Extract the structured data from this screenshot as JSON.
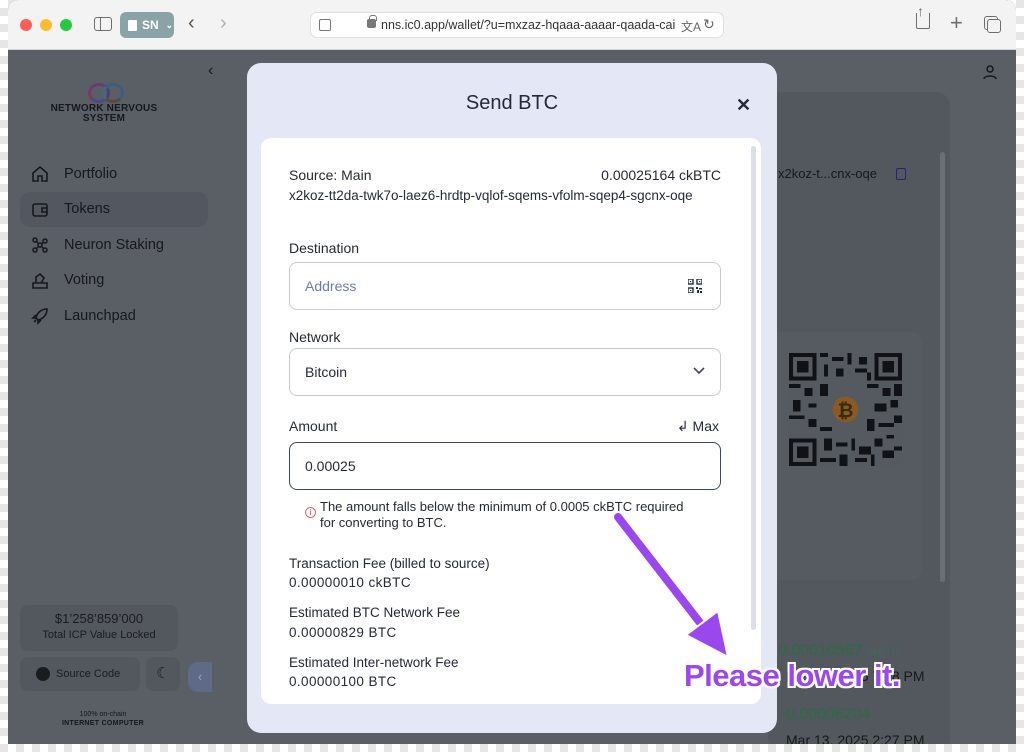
{
  "browser": {
    "tab_group_label": "SN",
    "url": "nns.ic0.app/wallet/?u=mxzaz-hqaaa-aaaar-qaada-cai"
  },
  "app": {
    "logo_line1": "NETWORK NERVOUS",
    "logo_line2": "SYSTEM",
    "nav": [
      {
        "label": "Portfolio",
        "icon": "home-icon"
      },
      {
        "label": "Tokens",
        "icon": "wallet-icon",
        "active": true
      },
      {
        "label": "Neuron Staking",
        "icon": "neuron-icon"
      },
      {
        "label": "Voting",
        "icon": "voting-icon"
      },
      {
        "label": "Launchpad",
        "icon": "rocket-icon"
      }
    ],
    "tvl_amount": "$1’258’859’000",
    "tvl_label": "Total ICP Value Locked",
    "source_code_label": "Source Code",
    "footer_line1": "100% on-chain",
    "footer_line2": "INTERNET COMPUTER",
    "right_address": "x2koz-t...cnx-oqe",
    "tx1_amount": "0.00010567",
    "tx1_unit": "ckBTC",
    "tx1_date": "Mar 13, 2025 7:08 PM",
    "tx2_amount": "0.00006204",
    "tx2_date": "Mar 13, 2025 2:27 PM"
  },
  "modal": {
    "title": "Send BTC",
    "source_label": "Source: Main",
    "source_balance": "0.00025164 ckBTC",
    "source_address": "x2koz-tt2da-twk7o-laez6-hrdtp-vqlof-sqems-vfolm-sqep4-sgcnx-oqe",
    "destination_label": "Destination",
    "destination_placeholder": "Address",
    "destination_value": "",
    "network_label": "Network",
    "network_value": "Bitcoin",
    "amount_label": "Amount",
    "max_label": "Max",
    "amount_value": "0.00025",
    "error_message": "The amount falls below the minimum of 0.0005 ckBTC required for converting to BTC.",
    "fees": [
      {
        "label": "Transaction Fee (billed to source)",
        "value": "0.00000010 ckBTC"
      },
      {
        "label": "Estimated BTC Network Fee",
        "value": "0.00000829 BTC"
      },
      {
        "label": "Estimated Inter-network Fee",
        "value": "0.00000100 BTC"
      }
    ]
  },
  "annotation": {
    "text": "Please lower it.",
    "color": "#9b47ee"
  },
  "colors": {
    "error": "#d7656b",
    "modal_bg": "#e3e7f6",
    "accent_text": "#262a36"
  }
}
